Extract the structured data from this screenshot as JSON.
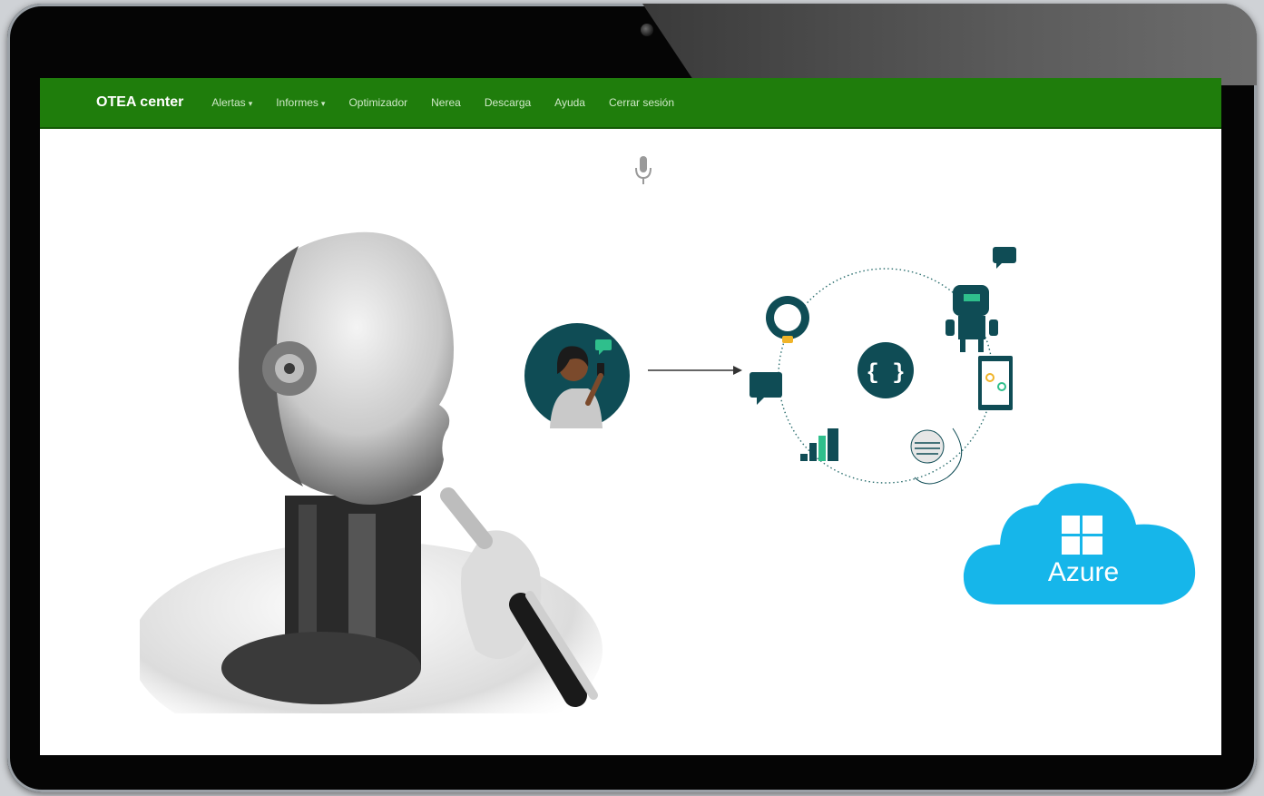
{
  "navbar": {
    "brand": "OTEA center",
    "items": [
      {
        "label": "Alertas",
        "dropdown": true
      },
      {
        "label": "Informes",
        "dropdown": true
      },
      {
        "label": "Optimizador",
        "dropdown": false
      },
      {
        "label": "Nerea",
        "dropdown": false
      },
      {
        "label": "Descarga",
        "dropdown": false
      },
      {
        "label": "Ayuda",
        "dropdown": false
      },
      {
        "label": "Cerrar sesión",
        "dropdown": false
      }
    ],
    "caret": "▾"
  },
  "icons": {
    "mic": "microphone-icon",
    "code": "{ }"
  },
  "azure": {
    "label": "Azure"
  },
  "colors": {
    "navbar": "#1f7d0c",
    "teal": "#0f4c55",
    "accent_green": "#2fbf8c",
    "azure_blue": "#16b6ea"
  }
}
